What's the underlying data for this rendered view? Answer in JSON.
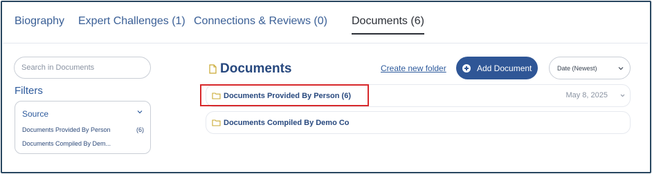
{
  "tabs": [
    {
      "label": "Biography"
    },
    {
      "label": "Expert Challenges (1)"
    },
    {
      "label": "Connections & Reviews (0)"
    },
    {
      "label": "Documents (6)",
      "active": true
    }
  ],
  "sidebar": {
    "search_placeholder": "Search in Documents",
    "filters_title": "Filters",
    "filter": {
      "heading": "Source",
      "options": [
        {
          "label": "Documents Provided By Person",
          "count": "(6)"
        },
        {
          "label": "Documents Compiled By Dem..."
        }
      ]
    }
  },
  "main": {
    "title": "Documents",
    "create_folder_link": "Create new folder",
    "add_button": "Add Document",
    "sort_value": "Date (Newest)",
    "folders": [
      {
        "name": "Documents Provided By Person (6)",
        "date": "May 8, 2025"
      },
      {
        "name": "Documents Compiled By Demo Co"
      }
    ]
  },
  "colors": {
    "accent": "#2f5696",
    "folder_icon": "#c9a830",
    "highlight_border": "#d7282b",
    "frame_border": "#27455f"
  },
  "icons": [
    "document-icon",
    "plus-circle-icon",
    "chevron-down-icon",
    "folder-icon"
  ]
}
